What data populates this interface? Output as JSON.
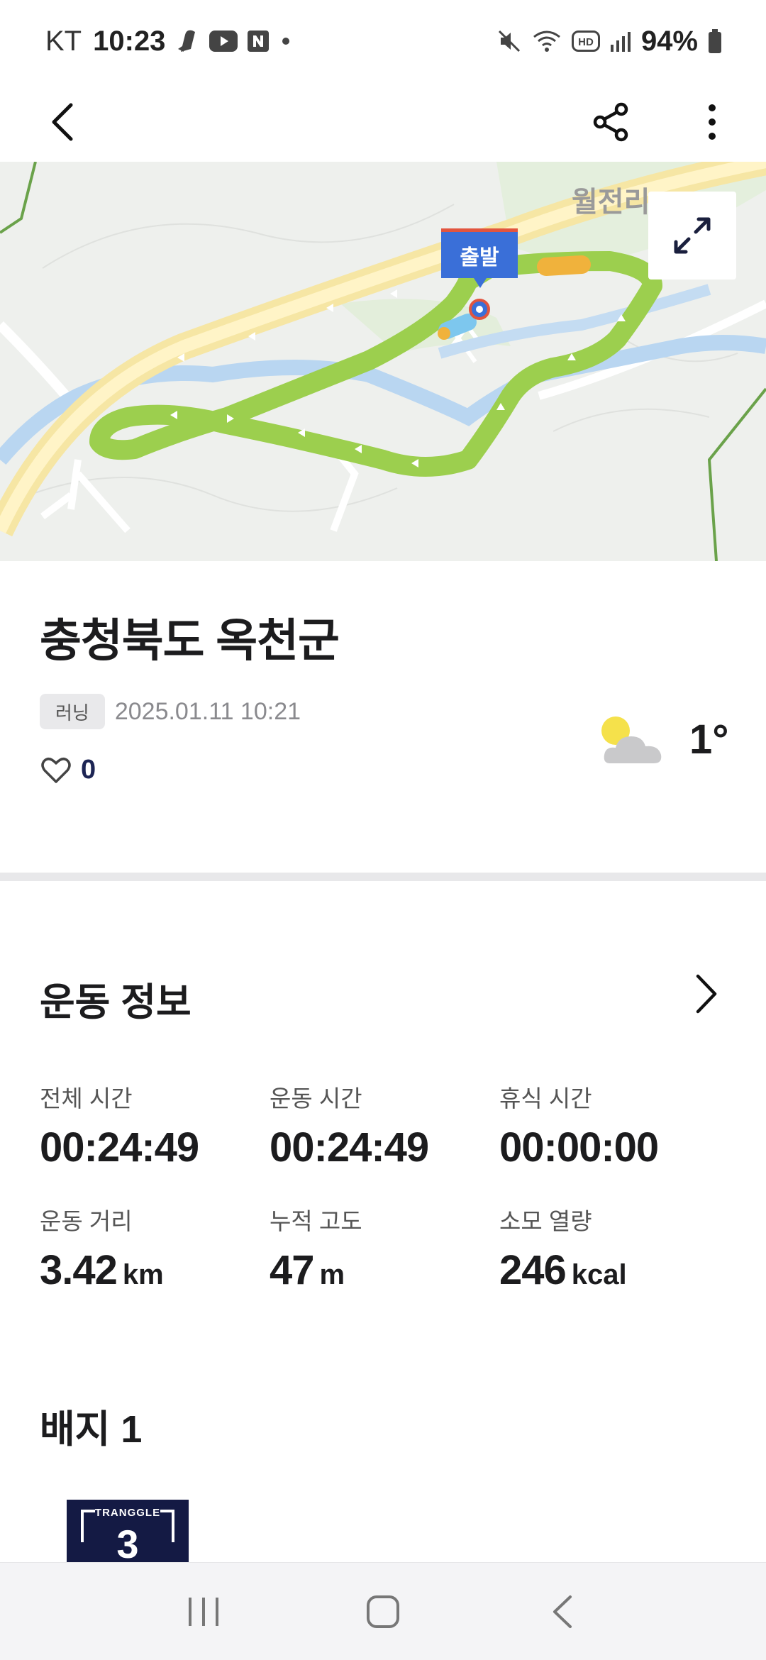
{
  "status_bar": {
    "carrier": "KT",
    "time": "10:23",
    "battery": "94%",
    "left_icons": [
      "notification-app-icon",
      "youtube-icon",
      "naver-icon",
      "dot-icon"
    ],
    "right_icons": [
      "mute-icon",
      "wifi-icon",
      "hd-icon",
      "signal-icon",
      "battery-icon"
    ]
  },
  "app_bar": {
    "back_icon": "back-arrow-icon",
    "share_icon": "share-icon",
    "more_icon": "more-vertical-icon"
  },
  "map": {
    "place_label": "월전리",
    "start_label": "출발",
    "expand_icon": "expand-icon",
    "route_color": "#9ccf4e"
  },
  "activity": {
    "location": "충청북도 옥천군",
    "type_tag": "러닝",
    "datetime": "2025.01.11 10:21",
    "likes": "0",
    "weather_icon": "partly-cloudy-icon",
    "temperature": "1°"
  },
  "exercise_info": {
    "title": "운동 정보",
    "stats": [
      {
        "label": "전체 시간",
        "value": "00:24:49",
        "unit": ""
      },
      {
        "label": "운동 시간",
        "value": "00:24:49",
        "unit": ""
      },
      {
        "label": "휴식 시간",
        "value": "00:00:00",
        "unit": ""
      },
      {
        "label": "운동 거리",
        "value": "3.42",
        "unit": "km"
      },
      {
        "label": "누적 고도",
        "value": "47",
        "unit": "m"
      },
      {
        "label": "소모 열량",
        "value": "246",
        "unit": "kcal"
      }
    ]
  },
  "badges": {
    "title": "배지 1",
    "items": [
      {
        "brand": "TRANGGLE",
        "number": "3"
      }
    ]
  },
  "nav_bar": {
    "icons": [
      "recent-apps-icon",
      "home-icon",
      "back-icon"
    ]
  },
  "colors": {
    "accent_blue": "#3a6fd8",
    "likes_navy": "#1d2554",
    "badge_navy": "#141a44"
  }
}
